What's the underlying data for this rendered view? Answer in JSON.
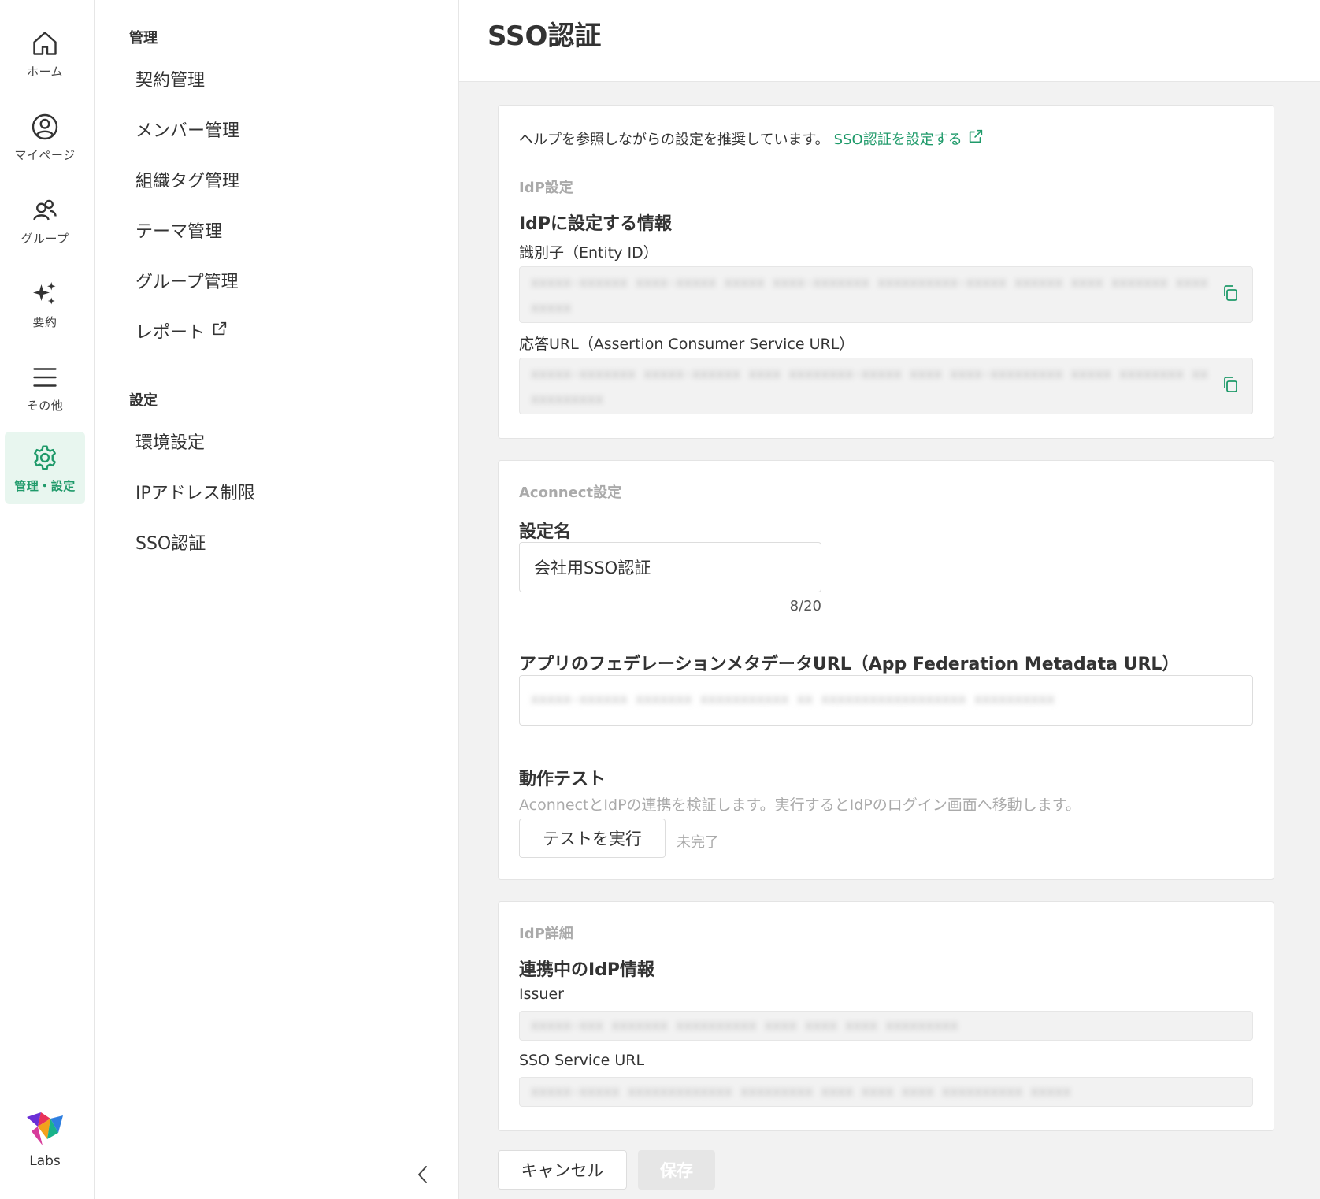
{
  "rail": {
    "items": [
      {
        "label": "ホーム",
        "icon": "home-icon"
      },
      {
        "label": "マイページ",
        "icon": "user-circle-icon"
      },
      {
        "label": "グループ",
        "icon": "group-icon"
      },
      {
        "label": "要約",
        "icon": "sparkle-icon"
      },
      {
        "label": "その他",
        "icon": "menu-icon"
      },
      {
        "label": "管理・設定",
        "icon": "gear-icon",
        "active": true
      }
    ],
    "logo_label": "Labs"
  },
  "subnav": {
    "sections": [
      {
        "heading": "管理",
        "items": [
          "契約管理",
          "メンバー管理",
          "組織タグ管理",
          "テーマ管理",
          "グループ管理",
          "レポート"
        ]
      },
      {
        "heading": "設定",
        "items": [
          "環境設定",
          "IPアドレス制限",
          "SSO認証"
        ]
      }
    ]
  },
  "header": {
    "title": "SSO認証"
  },
  "idp_card": {
    "help_text": "ヘルプを参照しながらの設定を推奨しています。",
    "help_link": "SSO認証を設定する",
    "section_label": "IdP設定",
    "title": "IdPに設定する情報",
    "entity_id_label": "識別子（Entity ID）",
    "entity_id_value": "xxxxx-xxxxxx xxxx-xxxxx xxxxx xxxx-xxxxxxx xxxxxxxxxx-xxxxx xxxxxx xxxx xxxxxxx xxxxxxxxx",
    "acs_url_label": "応答URL（Assertion Consumer Service URL）",
    "acs_url_value": "xxxxx-xxxxxxx xxxxx-xxxxxx xxxx xxxxxxxx-xxxxx xxxx xxxx-xxxxxxxxx xxxxx xxxxxxxx xxxxxxxxxxx"
  },
  "aconnect_card": {
    "section_label": "Aconnect設定",
    "setting_name_label": "設定名",
    "setting_name_value": "会社用SSO認証",
    "char_count": "8/20",
    "metadata_label": "アプリのフェデレーションメタデータURL（App Federation Metadata URL）",
    "metadata_value": "xxxxx-xxxxxx xxxxxxx xxxxxxxxxxx xx xxxxxxxxxxxxxxxxxx xxxxxxxxxx",
    "test_title": "動作テスト",
    "test_desc": "AconnectとIdPの連携を検証します。実行するとIdPのログイン画面へ移動します。",
    "test_button": "テストを実行",
    "test_status": "未完了"
  },
  "idp_detail_card": {
    "section_label": "IdP詳細",
    "title": "連携中のIdP情報",
    "issuer_label": "Issuer",
    "issuer_value": "xxxxx-xxx xxxxxxx xxxxxxxxxx xxxx xxxx xxxx xxxxxxxxx",
    "sso_url_label": "SSO Service URL",
    "sso_url_value": "xxxxx-xxxxx xxxxxxxxxxxxx xxxxxxxxx xxxx xxxx xxxx xxxxxxxxxx xxxxx"
  },
  "footer": {
    "cancel_button": "キャンセル",
    "save_button": "保存"
  },
  "colors": {
    "accent": "#1f9a6a",
    "active_bg": "#e8f6ef"
  }
}
